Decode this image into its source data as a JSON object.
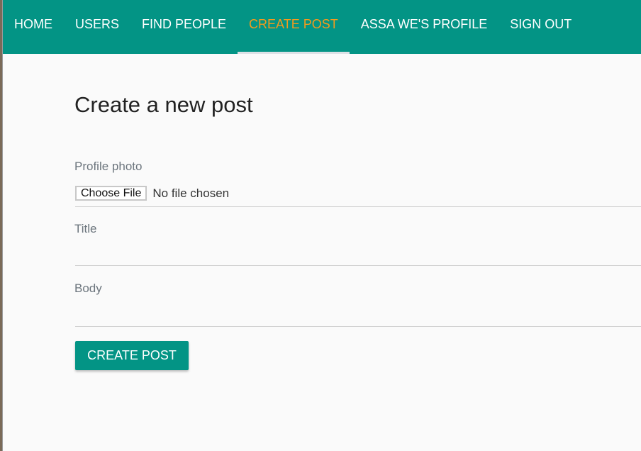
{
  "nav": {
    "items": [
      {
        "label": "HOME"
      },
      {
        "label": "USERS"
      },
      {
        "label": "FIND PEOPLE"
      },
      {
        "label": "CREATE POST",
        "active": true
      },
      {
        "label": "ASSA WE'S PROFILE"
      },
      {
        "label": "SIGN OUT"
      }
    ]
  },
  "page": {
    "title": "Create a new post"
  },
  "form": {
    "photo_label": "Profile photo",
    "choose_file": "Choose File",
    "no_file": "No file chosen",
    "title_label": "Title",
    "title_value": "",
    "body_label": "Body",
    "body_value": "",
    "submit": "CREATE POST"
  },
  "colors": {
    "primary": "#039485",
    "active": "#f49a1c"
  }
}
